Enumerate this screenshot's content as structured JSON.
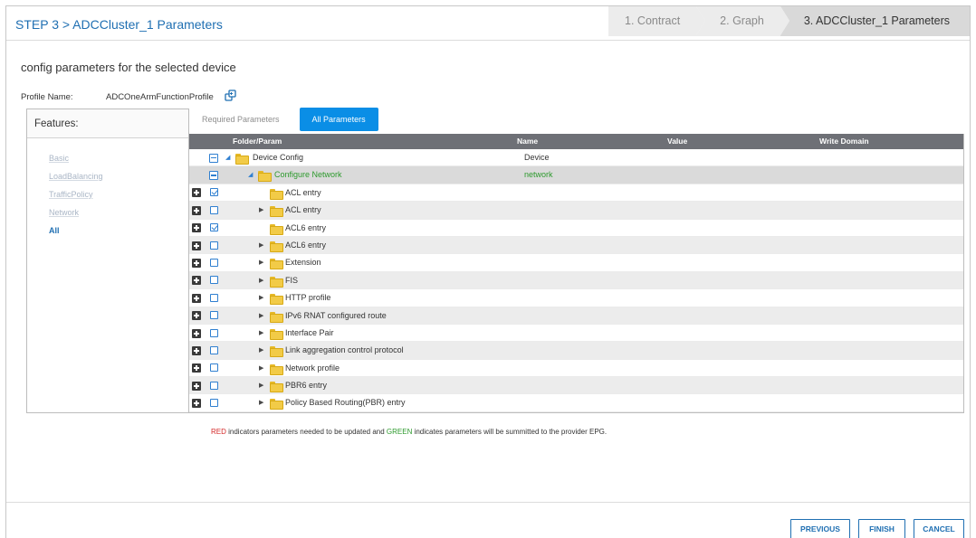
{
  "header": {
    "title": "STEP 3 > ADCCluster_1 Parameters",
    "steps": [
      "1. Contract",
      "2. Graph",
      "3. ADCCluster_1 Parameters"
    ]
  },
  "main": {
    "subtitle": "config parameters for the selected device",
    "profile_label": "Profile Name:",
    "profile_name": "ADCOneArmFunctionProfile"
  },
  "features": {
    "title": "Features:",
    "items": [
      "Basic",
      "LoadBalancing",
      "TrafficPolicy",
      "Network",
      "All"
    ],
    "selected": "All"
  },
  "tabs": [
    "Required Parameters",
    "All Parameters"
  ],
  "grid": {
    "columns": [
      "Folder/Param",
      "Name",
      "Value",
      "Write Domain"
    ],
    "rows": [
      {
        "label": "Device Config",
        "name": "Device"
      },
      {
        "label": "Configure Network",
        "name": "network"
      },
      {
        "label": "ACL entry",
        "name": ""
      },
      {
        "label": "ACL entry",
        "name": ""
      },
      {
        "label": "ACL6 entry",
        "name": ""
      },
      {
        "label": "ACL6 entry",
        "name": ""
      },
      {
        "label": "Extension",
        "name": ""
      },
      {
        "label": "FIS",
        "name": ""
      },
      {
        "label": "HTTP profile",
        "name": ""
      },
      {
        "label": "IPv6 RNAT configured route",
        "name": ""
      },
      {
        "label": "Interface Pair",
        "name": ""
      },
      {
        "label": "Link aggregation control protocol",
        "name": ""
      },
      {
        "label": "Network profile",
        "name": ""
      },
      {
        "label": "PBR6 entry",
        "name": ""
      },
      {
        "label": "Policy Based Routing(PBR) entry",
        "name": ""
      }
    ]
  },
  "legend": {
    "red_word": "RED",
    "part1": " indicators parameters needed to be updated and ",
    "green_word": "GREEN",
    "part2": " indicates parameters will be summitted to the provider EPG."
  },
  "buttons": {
    "previous": "PREVIOUS",
    "finish": "FINISH",
    "cancel": "CANCEL"
  },
  "colors": {
    "accent": "#1f6fb2",
    "tab_active": "#0a8ee6",
    "red": "#d42a2a",
    "green": "#2d9a2d"
  }
}
